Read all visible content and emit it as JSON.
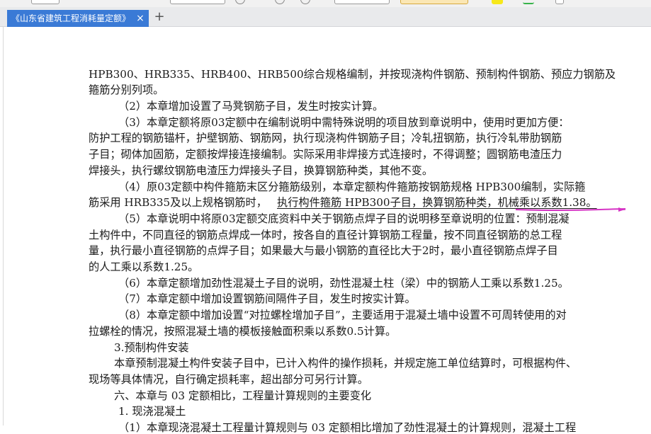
{
  "tab": {
    "title": "《山东省建筑工程消耗量定额》",
    "close": "×",
    "new": "+"
  },
  "colors": {
    "tab_bg": "#3a7ad6",
    "tabbar_bg": "#e9eaec",
    "pen_line": "#d633c5",
    "text": "#1b1b1b"
  },
  "document": {
    "lines": [
      "HPB300、HRB335、HRB400、HRB500综合规格编制，并按现浇构件钢筋、预制构件钢筋、预应力钢筋及",
      "箍筋分别列项。",
      "（2）本章增加设置了马凳钢筋子目，发生时按实计算。",
      "（3）本章定额将原03定额中在编制说明中需特殊说明的项目放到章说明中，使用时更加方便：",
      "防护工程的钢筋锚杆，护壁钢筋、钢筋网，执行现浇构件钢筋子目；冷轧扭钢筋，执行冷轧带肋钢筋",
      "子目；砌体加固筋，定额按焊接连接编制。实际采用非焊接方式连接时，不得调整；圆钢筋电渣压力",
      "焊接头，执行螺纹钢筋电渣压力焊接头子目，换算钢筋种类，其他不变。",
      "（4）原03定额中构件箍筋末区分箍筋级别，本章定额构件箍筋按钢筋规格 HPB300编制，实际箍",
      "筋采用 HRB335及以上规格钢筋时，",
      "执行构件箍筋 HPB300子目，换算钢筋种类，机械乘以系数1.38。",
      "（5）本章说明中将原03定额交底资料中关于钢筋点焊子目的说明移至章说明的位置：预制混凝",
      "土构件中，不同直径的钢筋点焊成一体时，按各自的直径计算钢筋工程量，按不同直径钢筋的总工程",
      "量，执行最小直径钢筋的点焊子目；如果最大与最小钢筋的直径比大于2时，最小直径钢筋点焊子目",
      "的人工乘以系数1.25。",
      "（6）本章定额增加劲性混凝土子目的说明，劲性混凝土柱（梁）中的钢筋人工乘以系数1.25。",
      "（7）本章定额中增加设置钢筋间隔件子目，发生时按实计算。",
      "（8）本章定额中增加设置“对拉螺栓增加子目”，主要适用于混凝土墙中设置不可周转使用的对",
      "拉螺栓的情况，按照混凝土墙的模板接触面积乘以系数0.5计算。",
      "3.预制构件安装",
      "本章预制混凝土构件安装子目中，已计入构件的操作损耗，并规定施工单位结算时，可根据构件、",
      "现场等具体情况，自行确定损耗率，超出部分可另行计算。",
      "六、本章与 03 定额相比，工程量计算规则的主要变化",
      "1. 现浇混凝土",
      "（1）本章现浇混凝土工程量计算规则与 03 定额相比增加了劲性混凝土的计算规则，混凝土工程"
    ]
  }
}
